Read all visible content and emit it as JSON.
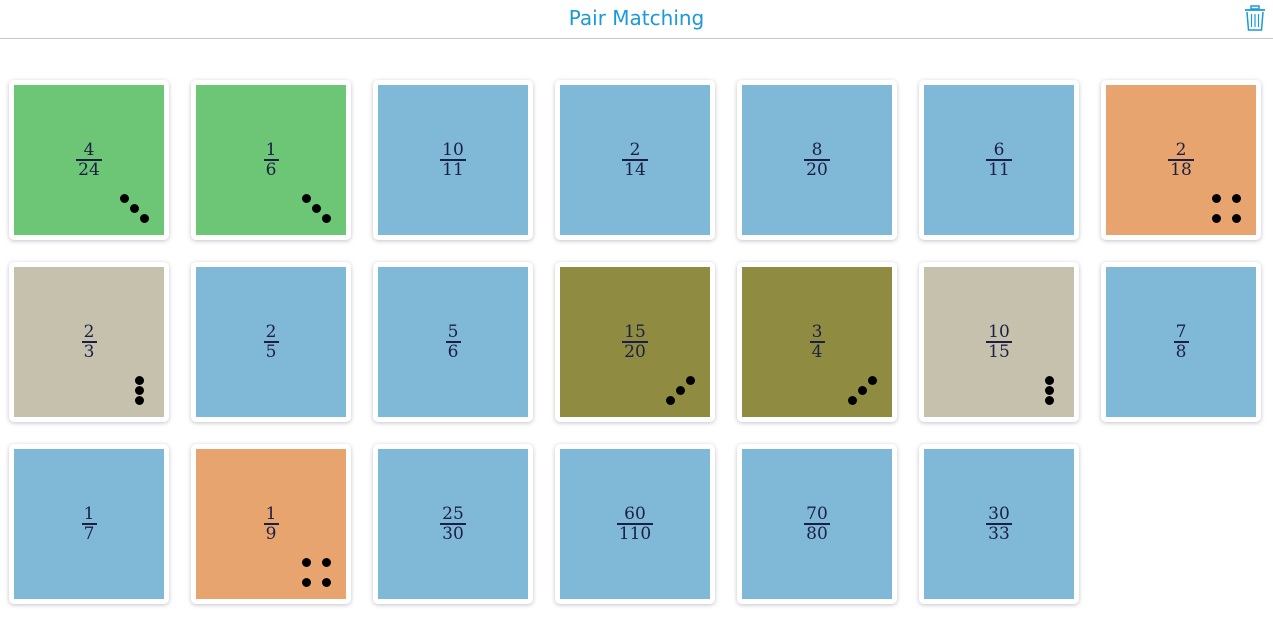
{
  "header": {
    "title": "Pair Matching",
    "trash_icon": "trash-icon"
  },
  "colors": {
    "title": "#1a9ad6",
    "unmatched": "#80b8d7",
    "green": "#6cc676",
    "orange": "#e8a46e",
    "beige": "#c6c1ad",
    "olive": "#8f8b41"
  },
  "cards": [
    {
      "num": "4",
      "den": "24",
      "color": "green",
      "marker": "diag-down"
    },
    {
      "num": "1",
      "den": "6",
      "color": "green",
      "marker": "diag-down"
    },
    {
      "num": "10",
      "den": "11",
      "color": "unmatched",
      "marker": ""
    },
    {
      "num": "2",
      "den": "14",
      "color": "unmatched",
      "marker": ""
    },
    {
      "num": "8",
      "den": "20",
      "color": "unmatched",
      "marker": ""
    },
    {
      "num": "6",
      "den": "11",
      "color": "unmatched",
      "marker": ""
    },
    {
      "num": "2",
      "den": "18",
      "color": "orange",
      "marker": "square"
    },
    {
      "num": "2",
      "den": "3",
      "color": "beige",
      "marker": "vertical"
    },
    {
      "num": "2",
      "den": "5",
      "color": "unmatched",
      "marker": ""
    },
    {
      "num": "5",
      "den": "6",
      "color": "unmatched",
      "marker": ""
    },
    {
      "num": "15",
      "den": "20",
      "color": "olive",
      "marker": "diag-up"
    },
    {
      "num": "3",
      "den": "4",
      "color": "olive",
      "marker": "diag-up"
    },
    {
      "num": "10",
      "den": "15",
      "color": "beige",
      "marker": "vertical"
    },
    {
      "num": "7",
      "den": "8",
      "color": "unmatched",
      "marker": ""
    },
    {
      "num": "1",
      "den": "7",
      "color": "unmatched",
      "marker": ""
    },
    {
      "num": "1",
      "den": "9",
      "color": "orange",
      "marker": "square"
    },
    {
      "num": "25",
      "den": "30",
      "color": "unmatched",
      "marker": ""
    },
    {
      "num": "60",
      "den": "110",
      "color": "unmatched",
      "marker": ""
    },
    {
      "num": "70",
      "den": "80",
      "color": "unmatched",
      "marker": ""
    },
    {
      "num": "30",
      "den": "33",
      "color": "unmatched",
      "marker": ""
    }
  ]
}
